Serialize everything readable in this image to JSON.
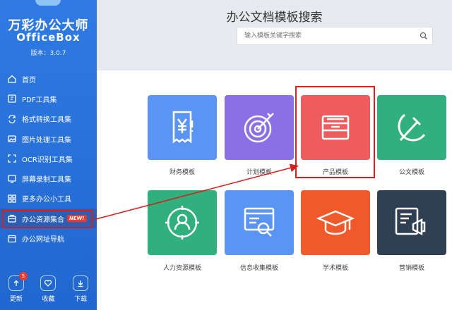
{
  "app": {
    "title": "万彩办公大师",
    "subtitle": "OfficeBox",
    "version": "版本：3.0.7"
  },
  "sidebar": {
    "items": [
      {
        "label": "首页",
        "icon": "home-icon"
      },
      {
        "label": "PDF工具集",
        "icon": "pdf-icon"
      },
      {
        "label": "格式转换工具集",
        "icon": "convert-icon"
      },
      {
        "label": "图片处理工具集",
        "icon": "image-icon"
      },
      {
        "label": "OCR识别工具集",
        "icon": "ocr-icon"
      },
      {
        "label": "屏幕录制工具集",
        "icon": "monitor-icon"
      },
      {
        "label": "更多办公小工具",
        "icon": "grid-icon"
      },
      {
        "label": "办公资源集合",
        "icon": "briefcase-icon",
        "badge": "NEW!",
        "active": true
      },
      {
        "label": "办公网址导航",
        "icon": "browser-icon"
      }
    ]
  },
  "bottom": {
    "update": {
      "label": "更新",
      "badge": "5"
    },
    "favorite": {
      "label": "收藏"
    },
    "download": {
      "label": "下载"
    }
  },
  "header": {
    "title": "办公文档模板搜索",
    "search_placeholder": "输入模板关键字搜索"
  },
  "templates": [
    {
      "label": "财务模板",
      "color": "#5b95f3",
      "icon": "receipt-icon"
    },
    {
      "label": "计划模板",
      "color": "#8a6fe6",
      "icon": "target-icon"
    },
    {
      "label": "产品模板",
      "color": "#ee5c5e",
      "icon": "box-icon",
      "highlighted": true
    },
    {
      "label": "公文模板",
      "color": "#2fb07c",
      "icon": "hammer-sickle-icon"
    },
    {
      "label": "人力资源模板",
      "color": "#2fb07c",
      "icon": "person-target-icon"
    },
    {
      "label": "信息收集模板",
      "color": "#5b95f3",
      "icon": "web-search-icon"
    },
    {
      "label": "学术模板",
      "color": "#f05a2a",
      "icon": "graduation-cap-icon"
    },
    {
      "label": "营销模板",
      "color": "#2f4052",
      "icon": "megaphone-icon"
    }
  ],
  "colors": {
    "sidebar": "#2f7be3",
    "highlight": "#d81e1e"
  }
}
